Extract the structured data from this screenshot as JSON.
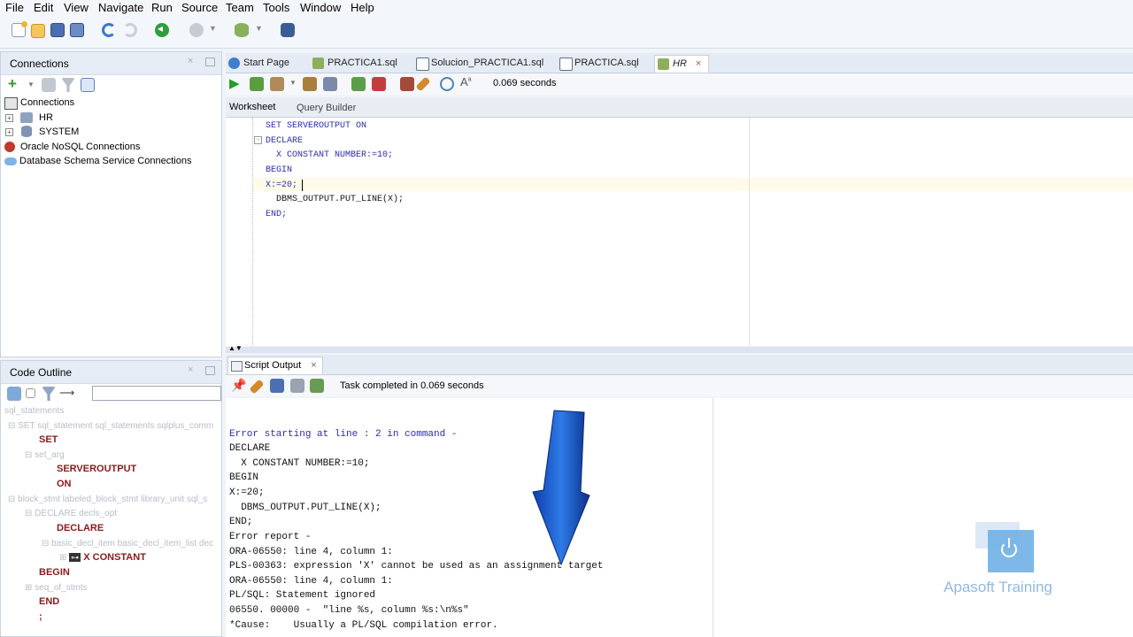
{
  "menu": [
    "File",
    "Edit",
    "View",
    "Navigate",
    "Run",
    "Source",
    "Team",
    "Tools",
    "Window",
    "Help"
  ],
  "connections": {
    "title": "Connections",
    "items": [
      {
        "label": "Connections"
      },
      {
        "label": "HR"
      },
      {
        "label": "SYSTEM"
      },
      {
        "label": "Oracle NoSQL Connections"
      },
      {
        "label": "Database Schema Service Connections"
      }
    ]
  },
  "tabs": [
    "Start Page",
    "PRACTICA1.sql",
    "Solucion_PRACTICA1.sql",
    "PRACTICA.sql",
    "HR"
  ],
  "editor_toolbar": {
    "timing": "0.069 seconds"
  },
  "subtabs": [
    "Worksheet",
    "Query Builder"
  ],
  "code_lines": [
    "SET SERVEROUTPUT ON",
    "DECLARE",
    "  X CONSTANT NUMBER:=10;",
    "BEGIN",
    "X:=20;",
    "  DBMS_OUTPUT.PUT_LINE(X);",
    "END;"
  ],
  "outline": {
    "title": "Code Outline",
    "rows": [
      {
        "text": "sql_statements",
        "style": "dim"
      },
      {
        "text": "SET sql_statement sql_statements sqlplus_comm",
        "style": "dim"
      },
      {
        "text": "SET",
        "style": "kw"
      },
      {
        "text": "set_arg",
        "style": "dim"
      },
      {
        "text": "SERVEROUTPUT",
        "style": "kw"
      },
      {
        "text": "ON",
        "style": "kw"
      },
      {
        "text": "block_stmt labeled_block_stmt library_unit sql_s",
        "style": "dim"
      },
      {
        "text": "DECLARE decls_opt",
        "style": "dim"
      },
      {
        "text": "DECLARE",
        "style": "kw"
      },
      {
        "text": "basic_decl_item basic_decl_item_list dec",
        "style": "dim"
      },
      {
        "text": "X CONSTANT",
        "style": "kw"
      },
      {
        "text": "BEGIN",
        "style": "kw"
      },
      {
        "text": "seq_of_stmts",
        "style": "dim"
      },
      {
        "text": "END",
        "style": "kw"
      },
      {
        "text": ";",
        "style": "kw"
      }
    ]
  },
  "script_output": {
    "title": "Script Output",
    "status": "Task completed in 0.069 seconds",
    "lines": [
      "Error starting at line : 2 in command -",
      "DECLARE",
      "  X CONSTANT NUMBER:=10;",
      "BEGIN",
      "X:=20;",
      "  DBMS_OUTPUT.PUT_LINE(X);",
      "END;",
      "Error report -",
      "ORA-06550: line 4, column 1:",
      "PLS-00363: expression 'X' cannot be used as an assignment target",
      "ORA-06550: line 4, column 1:",
      "PL/SQL: Statement ignored",
      "06550. 00000 -  \"line %s, column %s:\\n%s\"",
      "*Cause:    Usually a PL/SQL compilation error."
    ]
  },
  "watermark": {
    "text": "Apasoft Training"
  },
  "colors": {
    "accent": "#1f6fd1",
    "keyword": "#8b1a1a",
    "code": "#2b2bb0"
  }
}
